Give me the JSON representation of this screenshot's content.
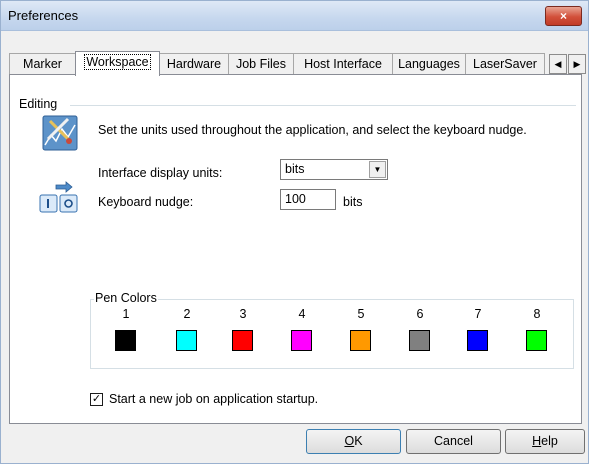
{
  "window": {
    "title": "Preferences",
    "close_glyph": "×"
  },
  "tabs": [
    {
      "label": "Marker",
      "active": false
    },
    {
      "label": "Workspace",
      "active": true
    },
    {
      "label": "Hardware",
      "active": false
    },
    {
      "label": "Job Files",
      "active": false
    },
    {
      "label": "Host Interface",
      "active": false
    },
    {
      "label": "Languages",
      "active": false
    },
    {
      "label": "LaserSaver",
      "active": false
    }
  ],
  "tab_scroll": {
    "left_glyph": "◀",
    "right_glyph": "▶"
  },
  "editing": {
    "group_label": "Editing",
    "description": "Set the units used throughout the application, and select the keyboard nudge.",
    "units_label": "Interface display units:",
    "units_value": "bits",
    "dropdown_glyph": "▼",
    "nudge_label": "Keyboard nudge:",
    "nudge_value": "100",
    "nudge_unit": "bits"
  },
  "pen_colors": {
    "label": "Pen Colors",
    "pens": [
      {
        "number": "1",
        "color": "#000000"
      },
      {
        "number": "2",
        "color": "#00ffff"
      },
      {
        "number": "3",
        "color": "#ff0000"
      },
      {
        "number": "4",
        "color": "#ff00ff"
      },
      {
        "number": "5",
        "color": "#ff9900"
      },
      {
        "number": "6",
        "color": "#808080"
      },
      {
        "number": "7",
        "color": "#0000ff"
      },
      {
        "number": "8",
        "color": "#00ff00"
      }
    ]
  },
  "startup": {
    "checked": true,
    "check_glyph": "✓",
    "label": "Start a new job on application startup."
  },
  "buttons": {
    "ok": {
      "mnemonic": "O",
      "rest": "K"
    },
    "cancel": {
      "label": "Cancel"
    },
    "help": {
      "mnemonic": "H",
      "rest": "elp"
    }
  }
}
